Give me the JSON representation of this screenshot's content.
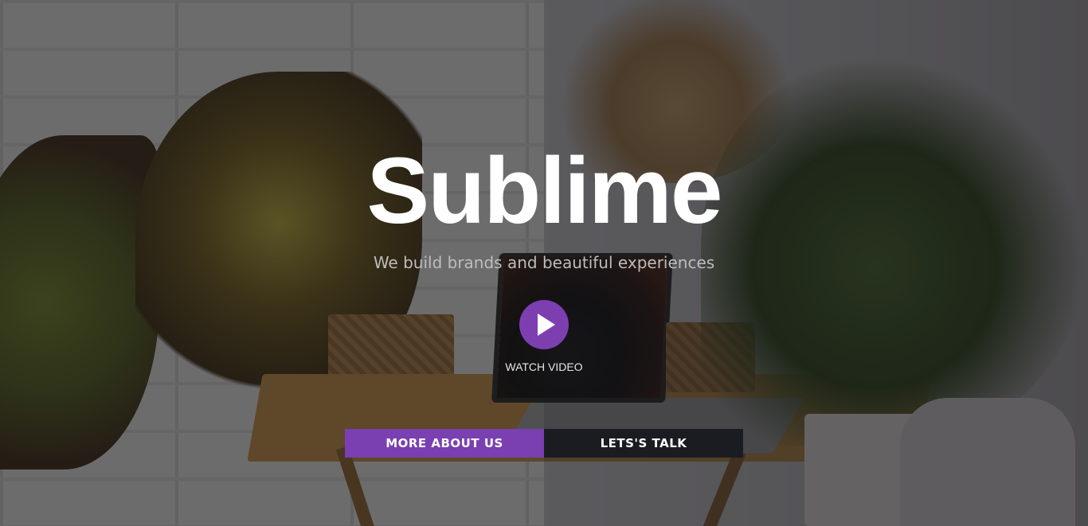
{
  "hero": {
    "title": "Sublime",
    "subtitle": "We build brands and beautiful experiences",
    "watch_video_label": "WATCH VIDEO",
    "more_about_label": "MORE ABOUT US",
    "lets_talk_label": "LETS'S TALK"
  },
  "colors": {
    "accent_purple": "#7a3fb0",
    "dark_button": "#1b1c22",
    "title": "#ffffff"
  },
  "icons": {
    "play": "play-icon"
  }
}
